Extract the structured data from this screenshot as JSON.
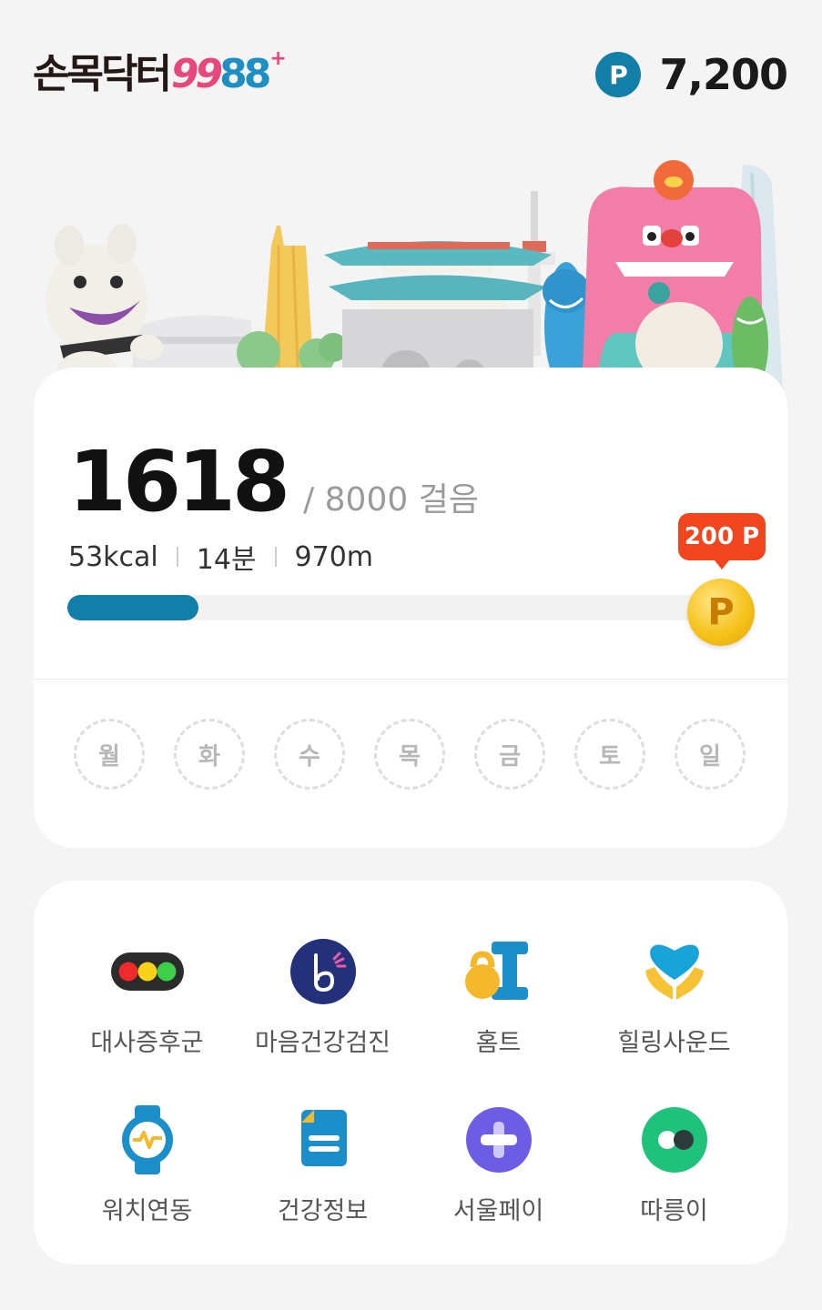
{
  "header": {
    "logo_korean": "손목닥터",
    "logo_99": "99",
    "logo_88": "88",
    "logo_plus": "+",
    "point_symbol": "P",
    "point_balance": "7,200"
  },
  "steps": {
    "current": "1618",
    "goal_text": "/ 8000 걸음",
    "progress_fraction": 0.2,
    "calories": "53kcal",
    "minutes": "14분",
    "distance": "970m",
    "reward_label": "200 P",
    "coin_symbol": "P"
  },
  "weekdays": [
    "월",
    "화",
    "수",
    "목",
    "금",
    "토",
    "일"
  ],
  "menu": [
    {
      "label": "대사증후군",
      "icon": "traffic-light-icon"
    },
    {
      "label": "마음건강검진",
      "icon": "mind-check-icon"
    },
    {
      "label": "홈트",
      "icon": "kettlebell-dumbbell-icon"
    },
    {
      "label": "힐링사운드",
      "icon": "heart-hands-icon"
    },
    {
      "label": "워치연동",
      "icon": "smartwatch-icon"
    },
    {
      "label": "건강정보",
      "icon": "document-icon"
    },
    {
      "label": "서울페이",
      "icon": "plus-circle-icon"
    },
    {
      "label": "따릉이",
      "icon": "bike-toggle-icon"
    }
  ],
  "colors": {
    "brand_blue": "#117fa8",
    "brand_pink": "#e8477c",
    "reward_red": "#f1451e",
    "coin_gold": "#f6c31b",
    "background": "#f4f4f5"
  }
}
